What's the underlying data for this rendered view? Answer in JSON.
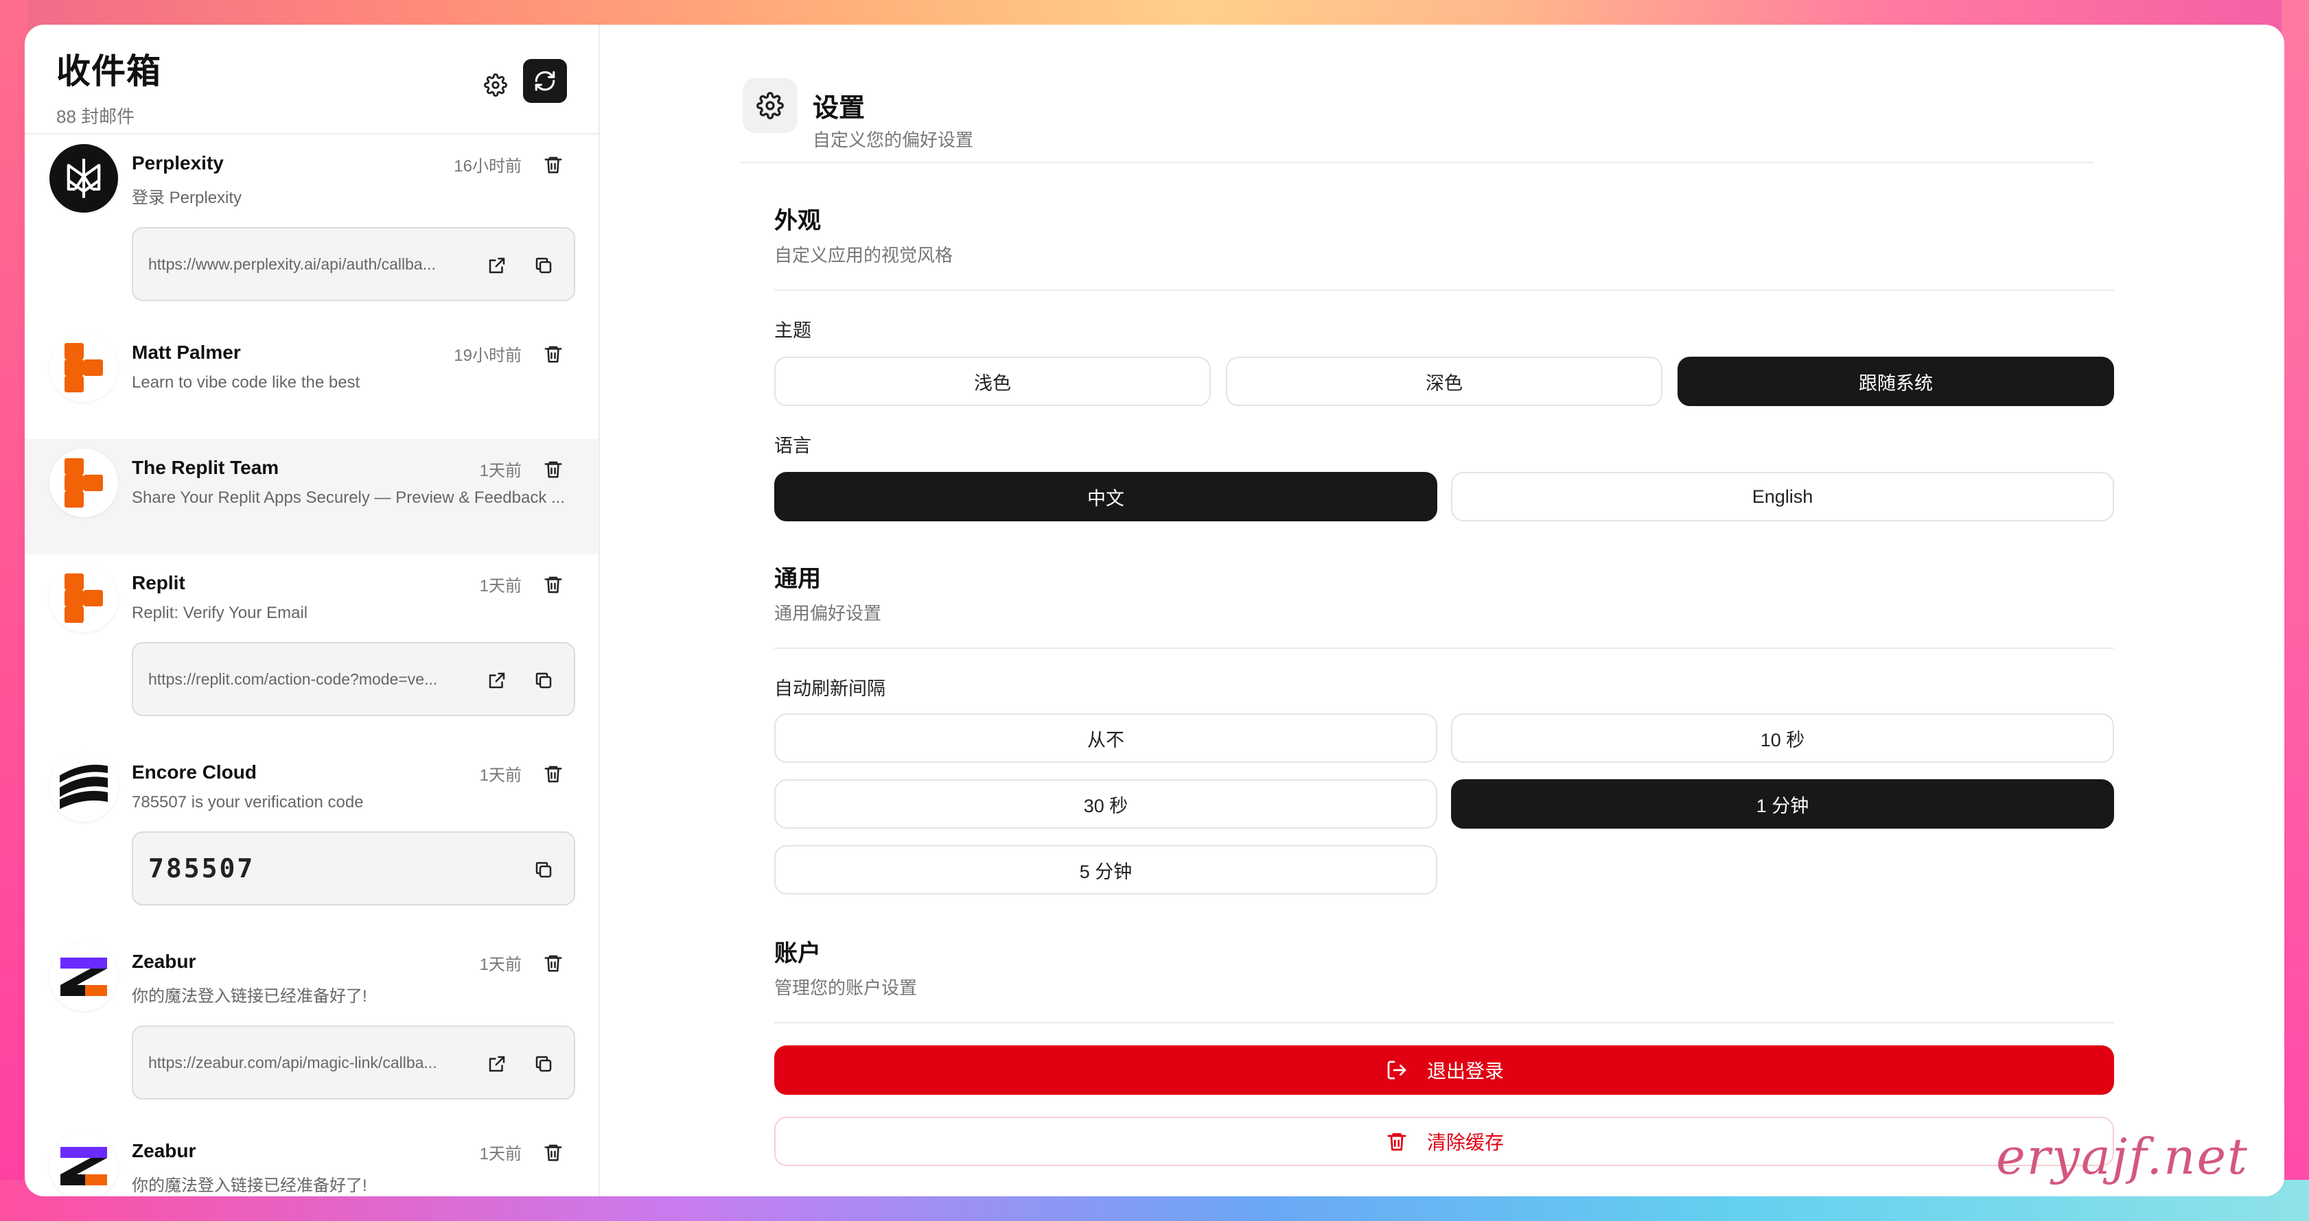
{
  "sidebar": {
    "title": "收件箱",
    "count": "88 封邮件",
    "mails": [
      {
        "sender": "Perplexity",
        "subject": "登录 Perplexity",
        "time": "16小时前",
        "avatar": "perplexity-logo",
        "box_type": "link",
        "box_text": "https://www.perplexity.ai/api/auth/callba..."
      },
      {
        "sender": "Matt Palmer",
        "subject": "Learn to vibe code like the best",
        "time": "19小时前",
        "avatar": "replit-logo"
      },
      {
        "sender": "The Replit Team",
        "subject": "Share Your Replit Apps Securely — Preview & Feedback ...",
        "time": "1天前",
        "avatar": "replit-logo",
        "active": true
      },
      {
        "sender": "Replit",
        "subject": "Replit: Verify Your Email",
        "time": "1天前",
        "avatar": "replit-logo",
        "box_type": "link",
        "box_text": "https://replit.com/action-code?mode=ve..."
      },
      {
        "sender": "Encore Cloud",
        "subject": "785507 is your verification code",
        "time": "1天前",
        "avatar": "encore-logo",
        "box_type": "code",
        "box_text": "785507"
      },
      {
        "sender": "Zeabur",
        "subject": "你的魔法登入链接已经准备好了!",
        "time": "1天前",
        "avatar": "zeabur-logo",
        "box_type": "link",
        "box_text": "https://zeabur.com/api/magic-link/callba..."
      },
      {
        "sender": "Zeabur",
        "subject": "你的魔法登入链接已经准备好了!",
        "time": "1天前",
        "avatar": "zeabur-logo"
      }
    ]
  },
  "settings": {
    "title": "设置",
    "subtitle": "自定义您的偏好设置",
    "appearance": {
      "title": "外观",
      "subtitle": "自定义应用的视觉风格",
      "theme_label": "主题",
      "themes": [
        "浅色",
        "深色",
        "跟随系统"
      ],
      "theme_selected": "跟随系统",
      "language_label": "语言",
      "languages": [
        "中文",
        "English"
      ],
      "language_selected": "中文"
    },
    "general": {
      "title": "通用",
      "subtitle": "通用偏好设置",
      "refresh_label": "自动刷新间隔",
      "intervals": [
        "从不",
        "10 秒",
        "30 秒",
        "1 分钟",
        "5 分钟"
      ],
      "interval_selected": "1 分钟"
    },
    "account": {
      "title": "账户",
      "subtitle": "管理您的账户设置",
      "logout": "退出登录",
      "clear_cache": "清除缓存"
    }
  },
  "watermark": "eryajf.net",
  "colors": {
    "primary_dark": "#18181b",
    "danger": "#e00012",
    "replit_orange": "#f26207",
    "zeabur_purple": "#6a2bff"
  }
}
